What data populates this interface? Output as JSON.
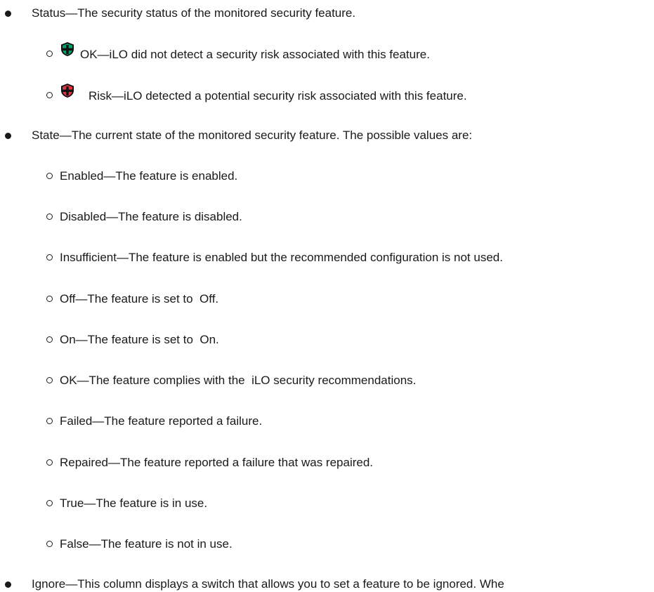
{
  "status": {
    "text": "Status—The security status of the monitored security feature.",
    "ok": {
      "icon": "shield-ok-icon",
      "color": "#00a16d",
      "text": "OK—iLO did not detect a security risk associated with this feature."
    },
    "risk": {
      "icon": "shield-risk-icon",
      "color": "#e0353f",
      "text": "Risk—iLO detected a potential security risk associated with this feature."
    }
  },
  "state": {
    "text": "State—The current state of the monitored security feature. The possible values are:",
    "values": [
      "Enabled—The feature is enabled.",
      "Disabled—The feature is disabled.",
      "Insufficient—The feature is enabled but the recommended configuration is not used.",
      "Off—The feature is set to  Off.",
      "On—The feature is set to  On.",
      "OK—The feature complies with the  iLO security recommendations.",
      "Failed—The feature reported a failure.",
      "Repaired—The feature reported a failure that was repaired.",
      "True—The feature is in use.",
      "False—The feature is not in use."
    ]
  },
  "ignore": {
    "text": "Ignore—This column displays a switch that allows you to set a feature to be ignored. Whe"
  }
}
